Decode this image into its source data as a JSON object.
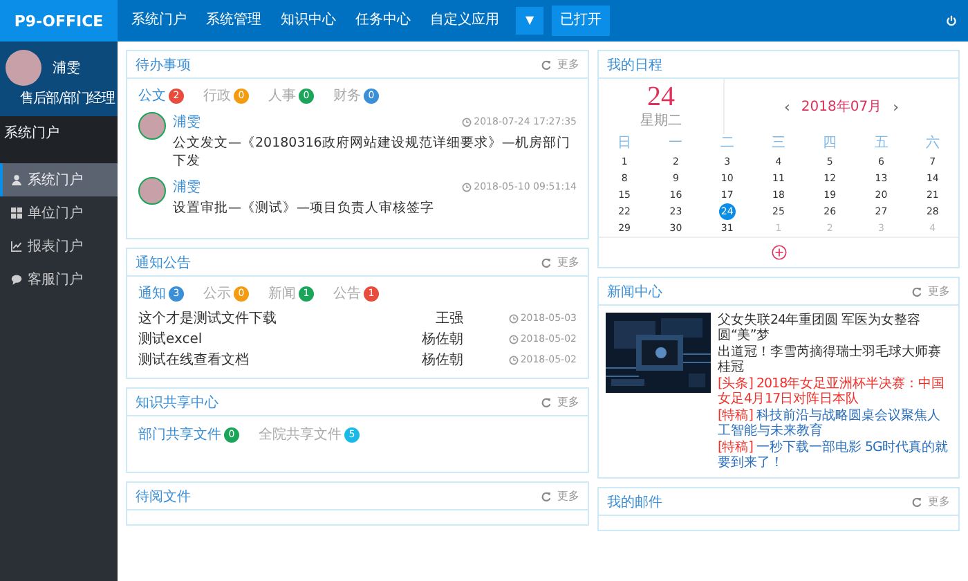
{
  "app": {
    "logo": "P9-OFFICE"
  },
  "nav": {
    "items": [
      {
        "label": "系统门户"
      },
      {
        "label": "系统管理"
      },
      {
        "label": "知识中心"
      },
      {
        "label": "任务中心"
      },
      {
        "label": "自定义应用"
      }
    ],
    "dropdown": "▼",
    "opened": "已打开"
  },
  "user": {
    "name": "浦雯",
    "role": "售后部/部门经理"
  },
  "sidebar": {
    "title": "系统门户",
    "items": [
      {
        "label": "系统门户",
        "kind": "user",
        "selected": true
      },
      {
        "label": "单位门户",
        "kind": "grid",
        "selected": false
      },
      {
        "label": "报表门户",
        "kind": "chart",
        "selected": false
      },
      {
        "label": "客服门户",
        "kind": "chat",
        "selected": false
      }
    ]
  },
  "todo": {
    "title": "待办事项",
    "more": "更多",
    "tabs": [
      {
        "label": "公文",
        "count": "2",
        "color": "#e74c3c",
        "selected": true
      },
      {
        "label": "行政",
        "count": "0",
        "color": "#f39c12",
        "selected": false
      },
      {
        "label": "人事",
        "count": "0",
        "color": "#1aa55a",
        "selected": false
      },
      {
        "label": "财务",
        "count": "0",
        "color": "#3a8fd6",
        "selected": false
      }
    ],
    "items": [
      {
        "name": "浦雯",
        "text": "公文发文—《20180316政府网站建设规范详细要求》—机房部门下发",
        "time": "2018-07-24 17:27:35"
      },
      {
        "name": "浦雯",
        "text": "设置审批—《测试》—项目负责人审核签字",
        "time": "2018-05-10 09:51:14"
      }
    ]
  },
  "notices": {
    "title": "通知公告",
    "more": "更多",
    "tabs": [
      {
        "label": "通知",
        "count": "3",
        "color": "#3a8fd6",
        "selected": true
      },
      {
        "label": "公示",
        "count": "0",
        "color": "#f39c12",
        "selected": false
      },
      {
        "label": "新闻",
        "count": "1",
        "color": "#1aa55a",
        "selected": false
      },
      {
        "label": "公告",
        "count": "1",
        "color": "#e74c3c",
        "selected": false
      }
    ],
    "rows": [
      {
        "title": "这个才是测试文件下载",
        "author": "王强",
        "date": "2018-05-03"
      },
      {
        "title": "测试excel",
        "author": "杨佐朝",
        "date": "2018-05-02"
      },
      {
        "title": "测试在线查看文档",
        "author": "杨佐朝",
        "date": "2018-05-02"
      }
    ]
  },
  "knowledge": {
    "title": "知识共享中心",
    "more": "更多",
    "tabs": [
      {
        "label": "部门共享文件",
        "count": "0",
        "color": "#1aa55a",
        "selected": true
      },
      {
        "label": "全院共享文件",
        "count": "5",
        "color": "#1cb8e8",
        "selected": false
      }
    ]
  },
  "pending": {
    "title": "待阅文件",
    "more": "更多"
  },
  "schedule": {
    "title": "我的日程",
    "day": "24",
    "weekday": "星期二",
    "month": "2018年07月",
    "prev": "‹",
    "next": "›",
    "weekdays": [
      "日",
      "一",
      "二",
      "三",
      "四",
      "五",
      "六"
    ],
    "days": [
      {
        "label": "1",
        "current": true,
        "selected": false
      },
      {
        "label": "2",
        "current": true,
        "selected": false
      },
      {
        "label": "3",
        "current": true,
        "selected": false
      },
      {
        "label": "4",
        "current": true,
        "selected": false
      },
      {
        "label": "5",
        "current": true,
        "selected": false
      },
      {
        "label": "6",
        "current": true,
        "selected": false
      },
      {
        "label": "7",
        "current": true,
        "selected": false
      },
      {
        "label": "8",
        "current": true,
        "selected": false
      },
      {
        "label": "9",
        "current": true,
        "selected": false
      },
      {
        "label": "10",
        "current": true,
        "selected": false
      },
      {
        "label": "11",
        "current": true,
        "selected": false
      },
      {
        "label": "12",
        "current": true,
        "selected": false
      },
      {
        "label": "13",
        "current": true,
        "selected": false
      },
      {
        "label": "14",
        "current": true,
        "selected": false
      },
      {
        "label": "15",
        "current": true,
        "selected": false
      },
      {
        "label": "16",
        "current": true,
        "selected": false
      },
      {
        "label": "17",
        "current": true,
        "selected": false
      },
      {
        "label": "18",
        "current": true,
        "selected": false
      },
      {
        "label": "19",
        "current": true,
        "selected": false
      },
      {
        "label": "20",
        "current": true,
        "selected": false
      },
      {
        "label": "21",
        "current": true,
        "selected": false
      },
      {
        "label": "22",
        "current": true,
        "selected": false
      },
      {
        "label": "23",
        "current": true,
        "selected": false
      },
      {
        "label": "24",
        "current": true,
        "selected": true
      },
      {
        "label": "25",
        "current": true,
        "selected": false
      },
      {
        "label": "26",
        "current": true,
        "selected": false
      },
      {
        "label": "27",
        "current": true,
        "selected": false
      },
      {
        "label": "28",
        "current": true,
        "selected": false
      },
      {
        "label": "29",
        "current": true,
        "selected": false
      },
      {
        "label": "30",
        "current": true,
        "selected": false
      },
      {
        "label": "31",
        "current": true,
        "selected": false
      },
      {
        "label": "1",
        "current": false,
        "selected": false
      },
      {
        "label": "2",
        "current": false,
        "selected": false
      },
      {
        "label": "3",
        "current": false,
        "selected": false
      },
      {
        "label": "4",
        "current": false,
        "selected": false
      }
    ]
  },
  "news": {
    "title": "新闻中心",
    "more": "更多",
    "items": [
      {
        "kind": "plain",
        "text": "父女失联24年重团圆 军医为女整容圆“美”梦"
      },
      {
        "kind": "plain",
        "text": "出道冠！李雪芮摘得瑞士羽毛球大师赛桂冠"
      },
      {
        "kind": "headline",
        "tag": "[头条]",
        "text": "2018年女足亚洲杯半决赛：中国女足4月17日对阵日本队"
      },
      {
        "kind": "feature",
        "tag": "[特稿]",
        "text": "科技前沿与战略圆桌会议聚焦人工智能与未来教育"
      },
      {
        "kind": "feature",
        "tag": "[特稿]",
        "text": "一秒下载一部电影 5G时代真的就要到来了！"
      }
    ]
  },
  "mail": {
    "title": "我的邮件",
    "more": "更多"
  }
}
